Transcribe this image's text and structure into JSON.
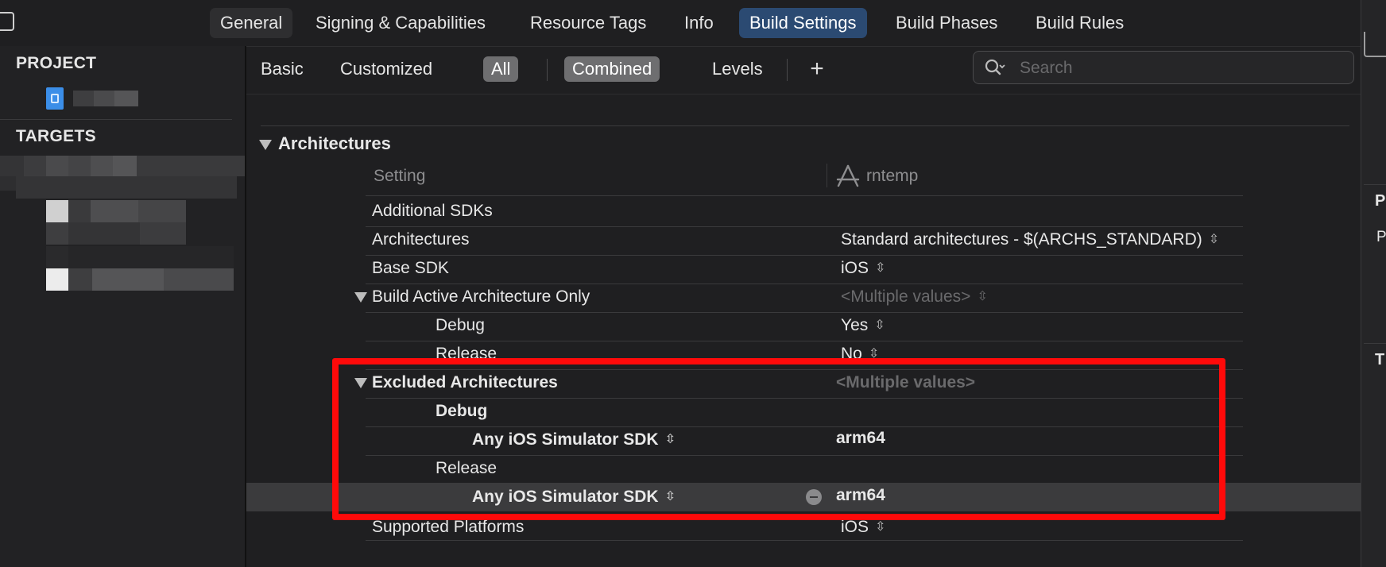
{
  "tabs": [
    "General",
    "Signing & Capabilities",
    "Resource Tags",
    "Info",
    "Build Settings",
    "Build Phases",
    "Build Rules"
  ],
  "sidebar": {
    "project_header": "PROJECT",
    "targets_header": "TARGETS"
  },
  "filter": {
    "basic": "Basic",
    "customized": "Customized",
    "all": "All",
    "combined": "Combined",
    "levels": "Levels",
    "add": "+",
    "search_placeholder": "Search"
  },
  "section": {
    "title": "Architectures",
    "col_setting": "Setting",
    "col_target": "rntemp"
  },
  "rows": {
    "additional_sdks": "Additional SDKs",
    "architectures": "Architectures",
    "architectures_value": "Standard architectures  -  $(ARCHS_STANDARD)",
    "base_sdk": "Base SDK",
    "base_sdk_value": "iOS",
    "baao": "Build Active Architecture Only",
    "baao_value": "<Multiple values>",
    "debug": "Debug",
    "debug_value": "Yes",
    "release": "Release",
    "release_value": "No",
    "excluded": "Excluded Architectures",
    "excluded_value": "<Multiple values>",
    "ex_debug": "Debug",
    "ex_debug_sdk": "Any iOS Simulator SDK",
    "ex_debug_value": "arm64",
    "ex_release": "Release",
    "ex_release_sdk": "Any iOS Simulator SDK",
    "ex_release_value": "arm64",
    "supported_platforms": "Supported Platforms",
    "supported_platforms_value": "iOS"
  },
  "right_pane": {
    "letter1": "P",
    "letter2": "P",
    "letter3": "T"
  },
  "colors": {
    "active_tab": "#2b4a72",
    "highlight": "#ff0a0a",
    "selected_row": "#3b3b3d"
  }
}
